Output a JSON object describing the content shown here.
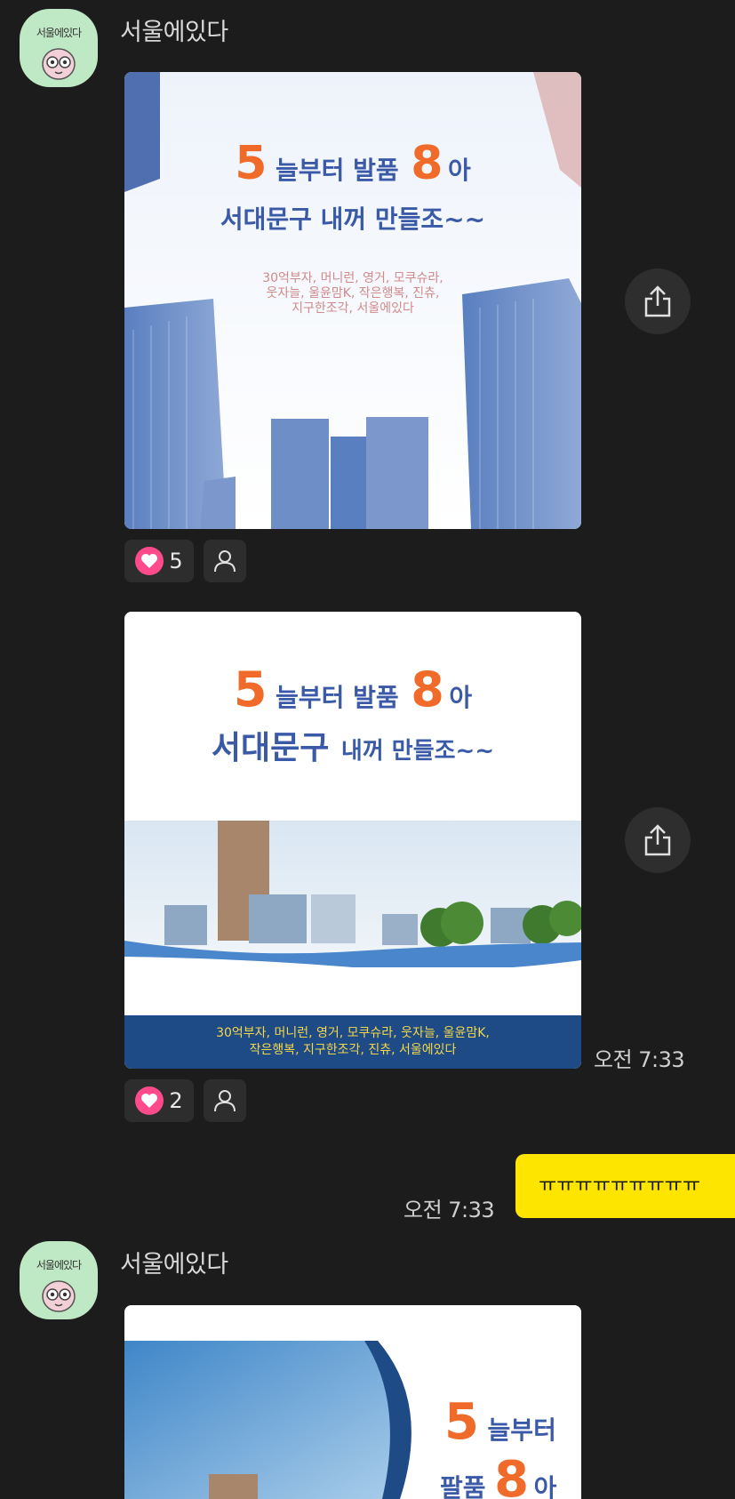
{
  "messages": [
    {
      "sender": "서울에있다",
      "avatar_label": "서울에있다",
      "photos": [
        {
          "headline_num1": "5",
          "headline_word1": "늘부터 발품",
          "headline_num2": "8",
          "headline_word2": "아",
          "subline": "서대문구 내꺼 만들조~~",
          "tagline_1": "30억부자, 머니런, 영거, 모쿠슈라,",
          "tagline_2": "웃자늘, 울윤맘K, 작은행복, 진츄,",
          "tagline_3": "지구한조각, 서울에있다",
          "likes": "5"
        },
        {
          "headline_num1": "5",
          "headline_word1": "늘부터 발품",
          "headline_num2": "8",
          "headline_word2": "아",
          "subline_big": "서대문구",
          "subline_small": "내꺼 만들조~~",
          "tagline_1": "30억부자, 머니런, 영거, 모쿠슈라, 웃자늘, 울윤맘K,",
          "tagline_2": "작은행복, 지구한조각, 진츄, 서울에있다",
          "likes": "2"
        }
      ],
      "time": "오전 7:33"
    },
    {
      "mine": true,
      "text": "ㅠㅠㅠㅠㅠㅠㅠㅠㅠ",
      "time": "오전 7:33"
    },
    {
      "sender": "서울에있다",
      "avatar_label": "서울에있다",
      "photos": [
        {
          "headline_num1": "5",
          "headline_word1": "늘부터",
          "headline_word2": "팔품",
          "headline_num2": "8",
          "headline_word3": "아"
        }
      ]
    }
  ],
  "colors": {
    "background": "#1c1c1c",
    "my_bubble": "#fee500",
    "heart": "#ff4a8c",
    "accent_orange": "#f06a2a",
    "accent_blue": "#3a5aa8"
  },
  "icons": [
    "share-icon",
    "heart-icon",
    "person-icon"
  ]
}
